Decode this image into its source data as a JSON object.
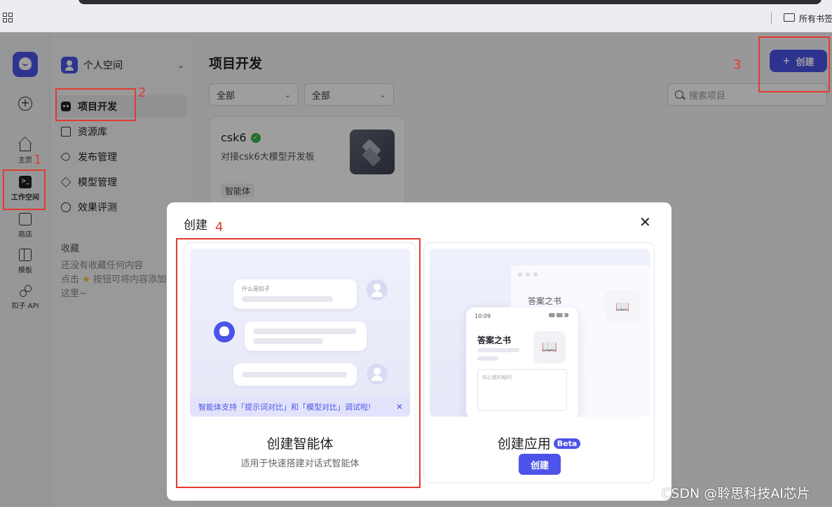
{
  "bookmarks": {
    "all_bookmarks": "所有书签"
  },
  "rail": {
    "home": "主页",
    "workspace": "工作空间",
    "store": "商店",
    "templates": "模板",
    "api": "扣子 API"
  },
  "sidebar": {
    "workspace_name": "个人空间",
    "items": [
      {
        "label": "项目开发"
      },
      {
        "label": "资源库"
      },
      {
        "label": "发布管理"
      },
      {
        "label": "模型管理"
      },
      {
        "label": "效果评测"
      }
    ],
    "favorites_title": "收藏",
    "favorites_empty_line1": "还没有收藏任何内容",
    "favorites_empty_line2_prefix": "点击",
    "favorites_empty_line2_suffix": "按钮可将内容添加",
    "favorites_empty_line3": "这里~"
  },
  "main": {
    "title": "项目开发",
    "create_label": "创建",
    "filter1": "全部",
    "filter2": "全部",
    "search_placeholder": "搜索项目",
    "card": {
      "name": "csk6",
      "desc": "对接csk6大模型开发板",
      "tag": "智能体"
    }
  },
  "modal": {
    "title": "创建",
    "agent": {
      "preview_question": "什么是扣子",
      "banner": "智能体支持「提示词对比」和「模型对比」调试啦!",
      "title": "创建智能体",
      "desc": "适用于快速搭建对话式智能体"
    },
    "app": {
      "window_title": "答案之书",
      "phone_time": "10:09",
      "phone_title": "答案之书",
      "phone_input": "你心底的疑问",
      "title": "创建应用",
      "beta": "Beta",
      "create_label": "创建"
    }
  },
  "annotations": {
    "n1": "1",
    "n2": "2",
    "n3": "3",
    "n4": "4"
  },
  "watermark": "CSDN @聆思科技AI芯片",
  "colors": {
    "accent": "#4d53e8",
    "annotation_red": "#e33b2e",
    "success": "#3ab54a"
  }
}
